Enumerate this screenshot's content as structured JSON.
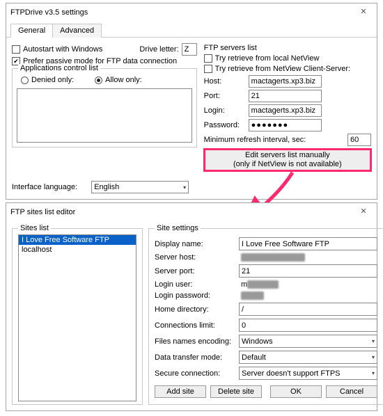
{
  "settingsWindow": {
    "title": "FTPDrive v3.5 settings",
    "tabs": {
      "general": "General",
      "advanced": "Advanced"
    },
    "autostart": "Autostart with Windows",
    "driveLetterLabel": "Drive letter:",
    "driveLetter": "Z",
    "preferPassive": "Prefer passive mode for FTP data connection",
    "appsControl": {
      "legend": "Applications control list",
      "denied": "Denied only:",
      "allow": "Allow only:"
    },
    "languageLabel": "Interface language:",
    "language": "English",
    "ftp": {
      "legend": "FTP servers list",
      "tryLocal": "Try retrieve from local NetView",
      "tryClientServer": "Try retrieve from NetView Client-Server:",
      "hostLabel": "Host:",
      "host": "mactagerts.xp3.biz",
      "portLabel": "Port:",
      "port": "21",
      "loginLabel": "Login:",
      "login": "mactagerts.xp3.biz",
      "passwordLabel": "Password:",
      "password": "●●●●●●●",
      "refreshLabel": "Minimum refresh interval, sec:",
      "refresh": "60",
      "editBtnLine1": "Edit servers list manually",
      "editBtnLine2": "(only if NetView is not available)"
    }
  },
  "editorWindow": {
    "title": "FTP sites list editor",
    "sitesLegend": "Sites list",
    "sites": {
      "item0": "I Love Free Software FTP",
      "item1": "localhost"
    },
    "settingsLegend": "Site settings",
    "displayNameLabel": "Display name:",
    "displayName": "I Love Free Software FTP",
    "serverHostLabel": "Server host:",
    "serverHost": "mactagerts.xp3.biz",
    "serverPortLabel": "Server port:",
    "serverPort": "21",
    "loginUserLabel": "Login user:",
    "loginUser": "mactagerts",
    "loginPasswordLabel": "Login password:",
    "loginPassword": "●●●",
    "homeDirLabel": "Home directory:",
    "homeDir": "/",
    "connLimitLabel": "Connections limit:",
    "connLimit": "0",
    "encLabel": "Files names encoding:",
    "enc": "Windows",
    "transferLabel": "Data transfer mode:",
    "transfer": "Default",
    "secureLabel": "Secure connection:",
    "secure": "Server doesn't support FTPS",
    "buttons": {
      "add": "Add site",
      "del": "Delete site",
      "ok": "OK",
      "cancel": "Cancel"
    }
  }
}
